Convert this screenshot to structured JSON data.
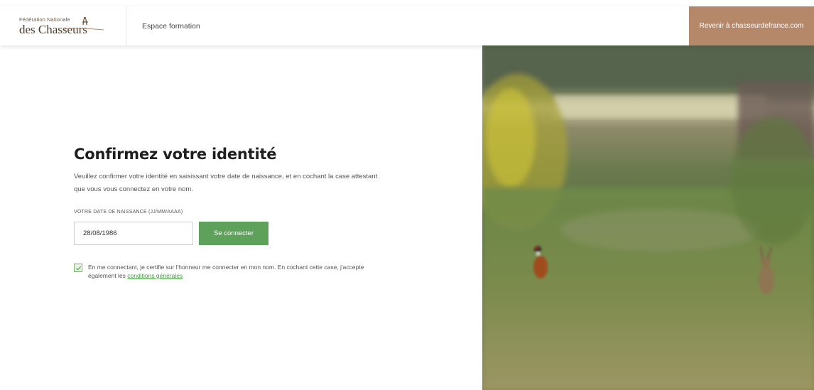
{
  "header": {
    "logo_line1": "Fédération Nationale",
    "logo_line2": "des Chasseurs",
    "nav_label": "Espace formation",
    "back_link_label": "Revenir à chasseurdefrance.com"
  },
  "main": {
    "title": "Confirmez votre identité",
    "intro": "Veuillez confirmer votre identité en saisissant votre date de naissance, et en cochant la case attestant que vous vous connectez en votre nom.",
    "date_label": "VOTRE DATE DE NAISSANCE (JJ/MM/AAAA)",
    "date_value": "28/08/1986",
    "connect_label": "Se connecter",
    "consent_text": "En me connectant, je certifie sur l'honneur me connecter en mon nom. En cochant cette case, j'accepte également les",
    "consent_link": "conditions générales",
    "consent_checked": true
  },
  "colors": {
    "accent_green": "#5da15a",
    "brand_brown": "#b48868",
    "title_highlight": "#c4df3a"
  },
  "icons": {
    "checkbox": "check-icon",
    "logo": "hunter-logo"
  }
}
